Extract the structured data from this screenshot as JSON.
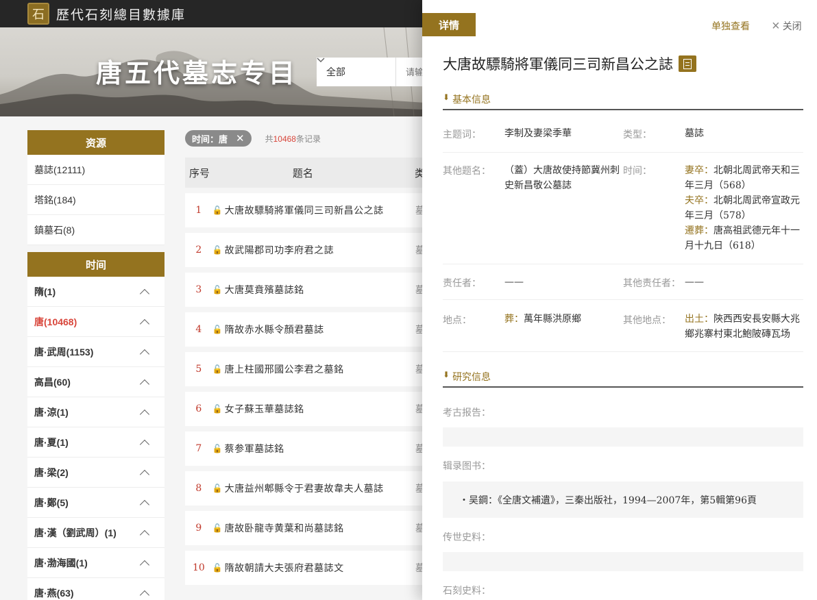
{
  "header": {
    "logo_glyph": "石",
    "site_title": "歷代石刻總目數據庫"
  },
  "banner": {
    "title": "唐五代墓志专目",
    "search_scope": "全部",
    "search_placeholder": "请输"
  },
  "sidebar": {
    "resource_title": "资源",
    "resources": [
      {
        "label": "墓誌(12111)"
      },
      {
        "label": "塔銘(184)"
      },
      {
        "label": "鎮墓石(8)"
      }
    ],
    "time_title": "时间",
    "times": [
      {
        "label": "隋(1)",
        "active": false
      },
      {
        "label": "唐(10468)",
        "active": true
      },
      {
        "label": "唐·武周(1153)",
        "active": false
      },
      {
        "label": "高昌(60)",
        "active": false
      },
      {
        "label": "唐·涼(1)",
        "active": false
      },
      {
        "label": "唐·夏(1)",
        "active": false
      },
      {
        "label": "唐·梁(2)",
        "active": false
      },
      {
        "label": "唐·鄭(5)",
        "active": false
      },
      {
        "label": "唐·漢（劉武周）(1)",
        "active": false
      },
      {
        "label": "唐·渤海國(1)",
        "active": false
      },
      {
        "label": "唐·燕(63)",
        "active": false
      }
    ]
  },
  "results": {
    "filter_label": "时间：唐",
    "filter_close": "✕",
    "count_prefix": "共",
    "count_value": "10468",
    "count_suffix": "条记录",
    "col_no": "序号",
    "col_title": "题名",
    "col_extra": "类",
    "rows": [
      {
        "no": "1",
        "title": "大唐故驃騎將軍儀同三司新昌公之誌",
        "extra": "墓"
      },
      {
        "no": "2",
        "title": "故武陽郡司功李府君之誌",
        "extra": "墓"
      },
      {
        "no": "3",
        "title": "大唐莫賁殯墓誌銘",
        "extra": "墓"
      },
      {
        "no": "4",
        "title": "隋故赤水縣令顏君墓誌",
        "extra": "墓"
      },
      {
        "no": "5",
        "title": "唐上柱國邢國公李君之墓銘",
        "extra": "墓"
      },
      {
        "no": "6",
        "title": "女子蘇玉華墓誌銘",
        "extra": "墓"
      },
      {
        "no": "7",
        "title": "蔡参軍墓誌銘",
        "extra": "墓"
      },
      {
        "no": "8",
        "title": "大唐益州郫縣令于君妻故韋夫人墓誌",
        "extra": "墓"
      },
      {
        "no": "9",
        "title": "唐故卧龍寺黄葉和尚墓誌銘",
        "extra": "墓"
      },
      {
        "no": "10",
        "title": "隋故朝請大夫張府君墓誌文",
        "extra": "墓"
      }
    ]
  },
  "detail": {
    "tab": "详情",
    "solo_view": "单独查看",
    "close_label": "关闭",
    "title": "大唐故驃騎將軍儀同三司新昌公之誌",
    "basic_section": "基本信息",
    "subject_label": "主题词：",
    "subject_value": "李制及妻梁季華",
    "type_label": "类型：",
    "type_value": "墓誌",
    "other_title_label": "其他题名：",
    "other_title_value": "（蓋）大唐故使持節冀州刺史新昌敬公墓誌",
    "time_label": "时间：",
    "time_entries": [
      {
        "prefix": "妻卒：",
        "text": "北朝北周武帝天和三年三月（568）"
      },
      {
        "prefix": "夫卒：",
        "text": "北朝北周武帝宣政元年三月（578）"
      },
      {
        "prefix": "遷葬：",
        "text": "唐高祖武德元年十一月十九日（618）"
      }
    ],
    "resp_label": "责任者：",
    "resp_value": "——",
    "other_resp_label": "其他责任者：",
    "other_resp_value": "——",
    "place_label": "地点：",
    "place_prefix": "葬：",
    "place_value": "萬年縣洪原鄉",
    "other_place_label": "其他地点：",
    "other_place_prefix": "出土：",
    "other_place_value": "陝西西安長安縣大兆鄉兆寨村東北鮑陂磚瓦场",
    "research_section": "研究信息",
    "archaeology_label": "考古报告：",
    "books_label": "辑录图书：",
    "books_value": "・吴鋼：《全唐文補遺》，三秦出版社，1994—2007年，第5輯第96頁",
    "history_label": "传世史料：",
    "stone_label": "石刻史料："
  }
}
